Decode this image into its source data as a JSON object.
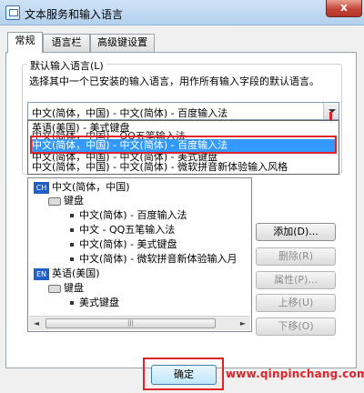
{
  "window": {
    "title": "文本服务和输入语言",
    "close_label": "x"
  },
  "tabs": [
    {
      "label": "常规"
    },
    {
      "label": "语言栏"
    },
    {
      "label": "高级键设置"
    }
  ],
  "default_input": {
    "group_label": "默认输入语言(L)",
    "description": "选择其中一个已安装的输入语言，用作所有输入字段的默认语言。",
    "selected_value": "中文(简体，中国) - 中文(简体) - 百度输入法",
    "options": [
      "英语(美国) - 美式键盘",
      "中文(简体，中国) - 中文(简体) - 百度输入法",
      "中文(简体，中国) - 中文(简体) - 美式键盘",
      "中文(简体，中国) - 中文(简体) - 微软拼音新体验输入风格"
    ],
    "overlap_fragment": "中文(简体，中国) - QQ五笔输入法",
    "selected_index": 1
  },
  "tree": {
    "languages": [
      {
        "badge": "CH",
        "name": "中文(简体，中国)",
        "group": "键盘",
        "items": [
          "中文(简体) - 百度输入法",
          "中文 - QQ五笔输入法",
          "中文(简体) - 美式键盘",
          "中文(简体) - 微软拼音新体验输入月"
        ]
      },
      {
        "badge": "EN",
        "name": "英语(美国)",
        "group": "键盘",
        "items": [
          "美式键盘"
        ]
      }
    ],
    "scroll_left": "◄",
    "scroll_right": "►",
    "scroll_thumb": "|||"
  },
  "side_buttons": [
    {
      "label": "添加(D)...",
      "enabled": true
    },
    {
      "label": "删除(R)",
      "enabled": false
    },
    {
      "label": "属性(P)...",
      "enabled": false
    },
    {
      "label": "上移(U)",
      "enabled": false
    },
    {
      "label": "下移(O)",
      "enabled": false
    }
  ],
  "footer": {
    "ok_label": "确定"
  },
  "watermark": "www.qinpinchang.com",
  "colors": {
    "highlight": "#3399ff",
    "annotation_red": "#e0232b",
    "lang_badge": "#1e5fc8"
  }
}
